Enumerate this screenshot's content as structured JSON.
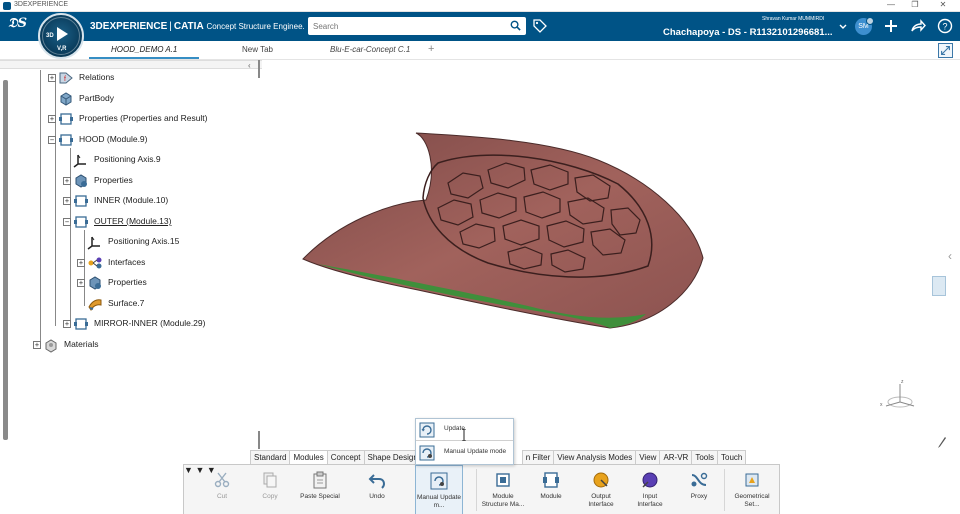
{
  "window": {
    "title": "3DEXPERIENCE"
  },
  "header": {
    "brand_bold": "3DEXPERIENCE",
    "brand_sep": "|",
    "brand_app": "CATIA",
    "brand_role": "Concept Structure Enginee.",
    "compass_3d": "3D",
    "compass_version": "V,R",
    "search": {
      "placeholder": "Search"
    },
    "user_name": "Shravan Kumar MUMMIRDI",
    "context": "Chachapoya - DS - R1132101296681...",
    "avatar_initials": "SM",
    "brand_color": "#005386"
  },
  "tabs": [
    {
      "label": "HOOD_DEMO A.1"
    },
    {
      "label": "New Tab"
    },
    {
      "label": "Blu-E-car-Concept C.1"
    }
  ],
  "tree": {
    "nodes": [
      {
        "label": "Relations",
        "icon": "relations-icon",
        "toggle": "+"
      },
      {
        "label": "PartBody",
        "icon": "partbody-icon",
        "toggle": ""
      },
      {
        "label": "Properties (Properties and Result)",
        "icon": "module-icon",
        "toggle": "+"
      },
      {
        "label": "HOOD (Module.9)",
        "icon": "module-icon",
        "toggle": "−"
      },
      {
        "label": "Positioning Axis.9",
        "icon": "axis-icon",
        "toggle": ""
      },
      {
        "label": "Properties",
        "icon": "properties-icon",
        "toggle": "+"
      },
      {
        "label": "INNER (Module.10)",
        "icon": "module-icon",
        "toggle": "+"
      },
      {
        "label": "OUTER (Module.13)",
        "icon": "module-icon",
        "toggle": "−"
      },
      {
        "label": "Positioning Axis.15",
        "icon": "axis-icon",
        "toggle": ""
      },
      {
        "label": "Interfaces",
        "icon": "interfaces-icon",
        "toggle": "+"
      },
      {
        "label": "Properties",
        "icon": "properties-icon",
        "toggle": "+"
      },
      {
        "label": "Surface.7",
        "icon": "surface-icon",
        "toggle": ""
      },
      {
        "label": "MIRROR-INNER (Module.29)",
        "icon": "module-icon",
        "toggle": "+"
      },
      {
        "label": "Materials",
        "icon": "materials-icon",
        "toggle": "+"
      }
    ]
  },
  "popup": {
    "items": [
      {
        "label": "Update"
      },
      {
        "label": "Manual Update mode"
      }
    ]
  },
  "section_tabs": [
    "Standard",
    "Modules",
    "Concept",
    "Shape Design",
    "n Filter",
    "View Analysis Modes",
    "View",
    "AR-VR",
    "Tools",
    "Touch"
  ],
  "actions": [
    {
      "label": "Cut",
      "icon": "cut-icon"
    },
    {
      "label": "Copy",
      "icon": "copy-icon"
    },
    {
      "label": "Paste Special",
      "icon": "paste-special-icon"
    },
    {
      "label": "Undo",
      "icon": "undo-icon"
    },
    {
      "label": "Manual Update m...",
      "icon": "manual-update-icon"
    },
    {
      "label": "Module Structure Ma...",
      "icon": "module-structure-icon"
    },
    {
      "label": "Module",
      "icon": "module-icon"
    },
    {
      "label": "Output Interface",
      "icon": "output-interface-icon"
    },
    {
      "label": "Input Interface",
      "icon": "input-interface-icon"
    },
    {
      "label": "Proxy",
      "icon": "proxy-icon"
    },
    {
      "label": "Geometrical Set...",
      "icon": "geometrical-set-icon"
    }
  ],
  "axis_labels": {
    "z": "z",
    "x": "x"
  }
}
